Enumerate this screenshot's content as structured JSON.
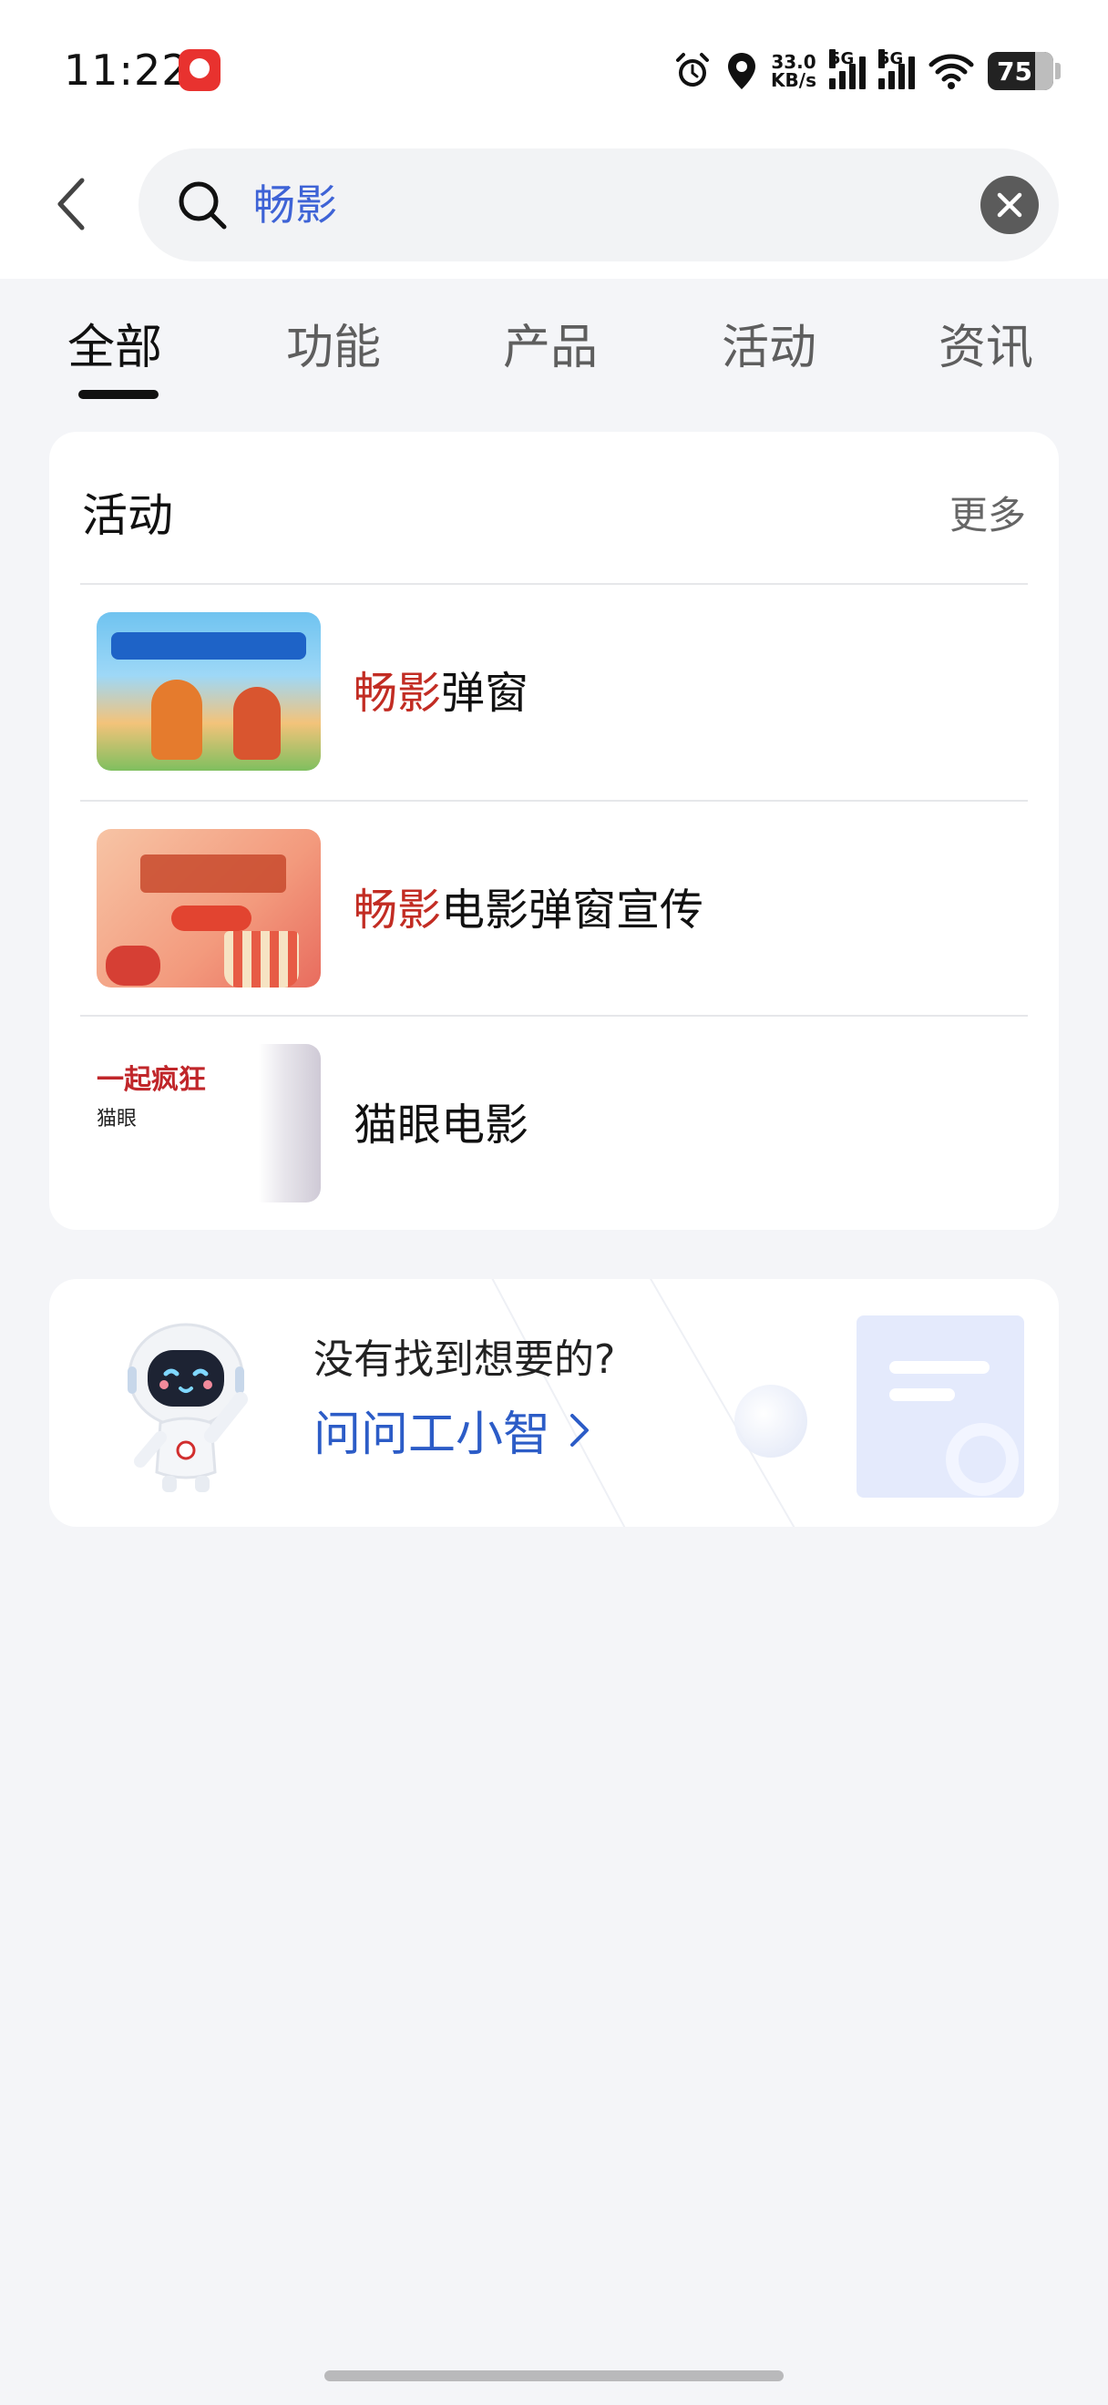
{
  "status_bar": {
    "time": "11:22",
    "net_speed_value": "33.0",
    "net_speed_unit": "KB/s",
    "signal1_label": "5G",
    "signal2_label": "5G",
    "battery": "75"
  },
  "search": {
    "query": "畅影"
  },
  "tabs": [
    {
      "label": "全部",
      "active": true
    },
    {
      "label": "功能",
      "active": false
    },
    {
      "label": "产品",
      "active": false
    },
    {
      "label": "活动",
      "active": false
    },
    {
      "label": "资讯",
      "active": false
    }
  ],
  "activity_section": {
    "title": "活动",
    "more": "更多",
    "items": [
      {
        "highlight": "畅影",
        "rest": "弹窗"
      },
      {
        "highlight": "畅影",
        "rest": "电影弹窗宣传"
      },
      {
        "highlight": "",
        "rest": "猫眼电影",
        "thumb_title": "一起疯狂",
        "thumb_sub": "猫眼"
      }
    ]
  },
  "assistant": {
    "question": "没有找到想要的?",
    "link": "问问工小智"
  },
  "colors": {
    "accent_blue": "#2c5cc7",
    "highlight_red": "#c22c23",
    "page_bg": "#f4f5f8"
  },
  "icons": [
    "back-chevron-icon",
    "search-icon",
    "clear-icon",
    "chevron-right-icon",
    "robot-mascot-icon",
    "alarm-icon",
    "location-icon",
    "wifi-icon"
  ]
}
